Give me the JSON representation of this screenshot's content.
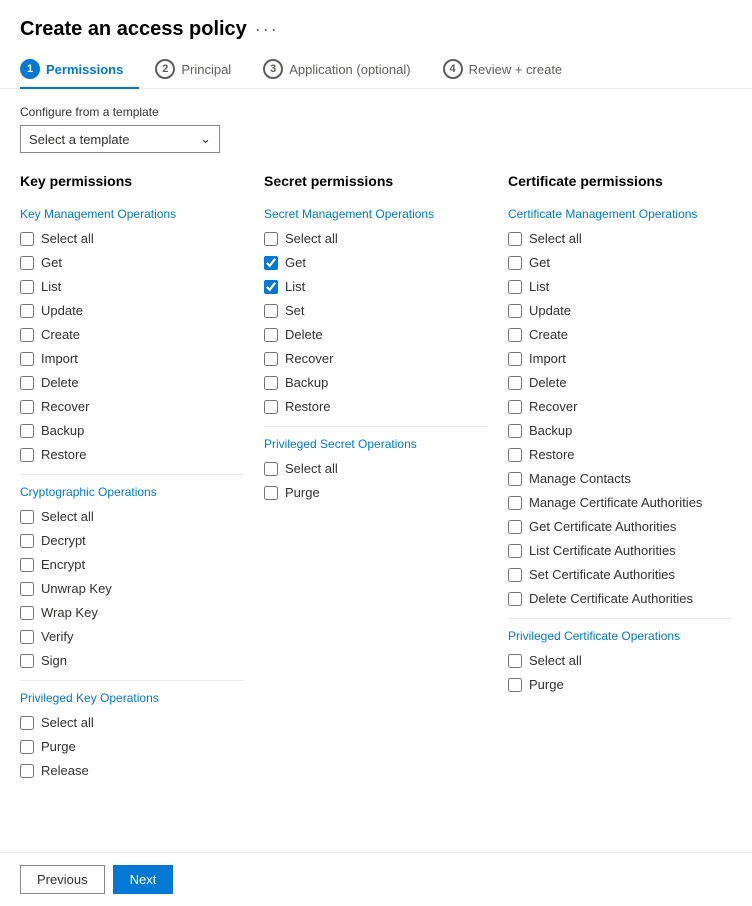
{
  "header": {
    "title": "Create an access policy",
    "dots": "···"
  },
  "nav": {
    "tabs": [
      {
        "number": "1",
        "label": "Permissions",
        "active": true
      },
      {
        "number": "2",
        "label": "Principal",
        "active": false
      },
      {
        "number": "3",
        "label": "Application (optional)",
        "active": false
      },
      {
        "number": "4",
        "label": "Review + create",
        "active": false
      }
    ]
  },
  "template": {
    "label": "Configure from a template",
    "placeholder": "Select a template"
  },
  "columns": {
    "key": {
      "header": "Key permissions",
      "sections": [
        {
          "name": "Key Management Operations",
          "items": [
            {
              "label": "Select all",
              "checked": false
            },
            {
              "label": "Get",
              "checked": false
            },
            {
              "label": "List",
              "checked": false
            },
            {
              "label": "Update",
              "checked": false
            },
            {
              "label": "Create",
              "checked": false
            },
            {
              "label": "Import",
              "checked": false
            },
            {
              "label": "Delete",
              "checked": false
            },
            {
              "label": "Recover",
              "checked": false
            },
            {
              "label": "Backup",
              "checked": false
            },
            {
              "label": "Restore",
              "checked": false
            }
          ]
        },
        {
          "name": "Cryptographic Operations",
          "items": [
            {
              "label": "Select all",
              "checked": false
            },
            {
              "label": "Decrypt",
              "checked": false
            },
            {
              "label": "Encrypt",
              "checked": false
            },
            {
              "label": "Unwrap Key",
              "checked": false
            },
            {
              "label": "Wrap Key",
              "checked": false
            },
            {
              "label": "Verify",
              "checked": false
            },
            {
              "label": "Sign",
              "checked": false
            }
          ]
        },
        {
          "name": "Privileged Key Operations",
          "items": [
            {
              "label": "Select all",
              "checked": false
            },
            {
              "label": "Purge",
              "checked": false
            },
            {
              "label": "Release",
              "checked": false
            }
          ]
        }
      ]
    },
    "secret": {
      "header": "Secret permissions",
      "sections": [
        {
          "name": "Secret Management Operations",
          "items": [
            {
              "label": "Select all",
              "checked": false
            },
            {
              "label": "Get",
              "checked": true
            },
            {
              "label": "List",
              "checked": true
            },
            {
              "label": "Set",
              "checked": false
            },
            {
              "label": "Delete",
              "checked": false
            },
            {
              "label": "Recover",
              "checked": false
            },
            {
              "label": "Backup",
              "checked": false
            },
            {
              "label": "Restore",
              "checked": false
            }
          ]
        },
        {
          "name": "Privileged Secret Operations",
          "items": [
            {
              "label": "Select all",
              "checked": false
            },
            {
              "label": "Purge",
              "checked": false
            }
          ]
        }
      ]
    },
    "certificate": {
      "header": "Certificate permissions",
      "sections": [
        {
          "name": "Certificate Management Operations",
          "items": [
            {
              "label": "Select all",
              "checked": false
            },
            {
              "label": "Get",
              "checked": false
            },
            {
              "label": "List",
              "checked": false
            },
            {
              "label": "Update",
              "checked": false
            },
            {
              "label": "Create",
              "checked": false
            },
            {
              "label": "Import",
              "checked": false
            },
            {
              "label": "Delete",
              "checked": false
            },
            {
              "label": "Recover",
              "checked": false
            },
            {
              "label": "Backup",
              "checked": false
            },
            {
              "label": "Restore",
              "checked": false
            },
            {
              "label": "Manage Contacts",
              "checked": false
            },
            {
              "label": "Manage Certificate Authorities",
              "checked": false
            },
            {
              "label": "Get Certificate Authorities",
              "checked": false
            },
            {
              "label": "List Certificate Authorities",
              "checked": false
            },
            {
              "label": "Set Certificate Authorities",
              "checked": false
            },
            {
              "label": "Delete Certificate Authorities",
              "checked": false
            }
          ]
        },
        {
          "name": "Privileged Certificate Operations",
          "items": [
            {
              "label": "Select all",
              "checked": false
            },
            {
              "label": "Purge",
              "checked": false
            }
          ]
        }
      ]
    }
  },
  "footer": {
    "previous_label": "Previous",
    "next_label": "Next"
  }
}
